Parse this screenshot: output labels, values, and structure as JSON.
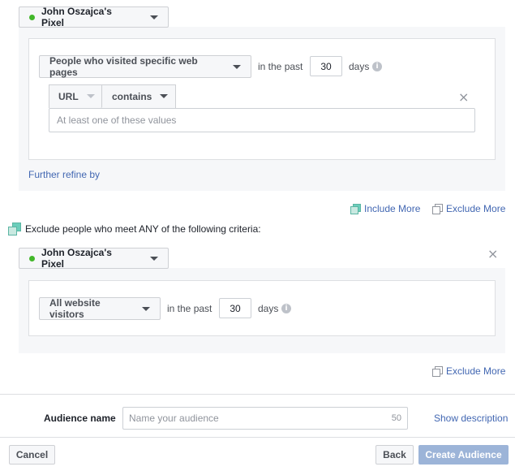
{
  "include_block": {
    "pixel_name": "John Oszajca's Pixel",
    "rule_type": "People who visited specific web pages",
    "in_the_past": "in the past",
    "days_value": "30",
    "days_label": "days",
    "info": "i",
    "url_dropdown": "URL",
    "operator_dropdown": "contains",
    "values_placeholder": "At least one of these values",
    "refine_link": "Further refine by",
    "close": "×"
  },
  "actions": {
    "include_more": "Include More",
    "exclude_more": "Exclude More"
  },
  "exclude_section": {
    "heading": "Exclude people who meet ANY of the following criteria:",
    "pixel_name": "John Oszajca's Pixel",
    "rule_type": "All website visitors",
    "in_the_past": "in the past",
    "days_value": "30",
    "days_label": "days",
    "info": "i",
    "close": "×",
    "exclude_more": "Exclude More"
  },
  "audience": {
    "name_label": "Audience name",
    "name_placeholder": "Name your audience",
    "char_limit": "50",
    "show_description": "Show description"
  },
  "footer": {
    "cancel": "Cancel",
    "back": "Back",
    "create": "Create Audience"
  },
  "colors": {
    "link": "#4267b2",
    "pixel_status": "#42b72a",
    "create_disabled": "#9cb4d8"
  }
}
